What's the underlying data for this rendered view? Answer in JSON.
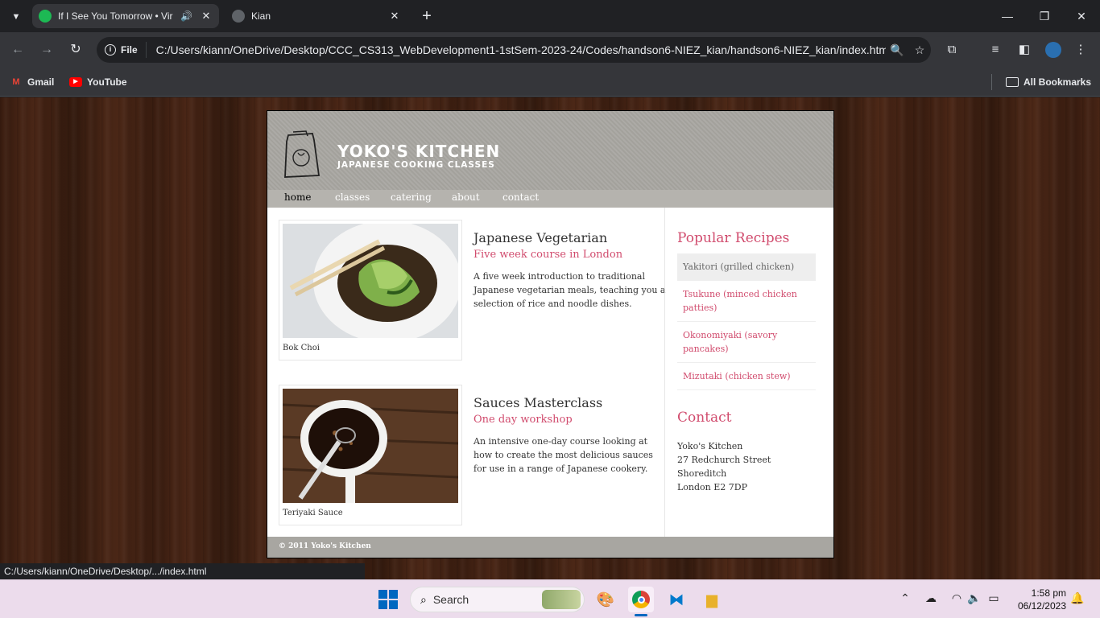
{
  "browser": {
    "tabs": [
      {
        "title": "If I See You Tomorrow • Vir",
        "active": true,
        "favicon": "spotify-icon",
        "favicon_color": "#1db954"
      },
      {
        "title": "Kian",
        "active": false,
        "favicon": "globe-icon"
      }
    ],
    "omnibox": {
      "chip_label": "File",
      "url": "C:/Users/kiann/OneDrive/Desktop/CCC_CS313_WebDevelopment1-1stSem-2023-24/Codes/handson6-NIEZ_kian/handson6-NIEZ_kian/index.html"
    },
    "bookmarks": [
      {
        "label": "Gmail",
        "icon": "gmail-icon"
      },
      {
        "label": "YouTube",
        "icon": "youtube-icon"
      }
    ],
    "all_bookmarks_label": "All Bookmarks",
    "status_url": "C:/Users/kiann/OneDrive/Desktop/.../index.html"
  },
  "site": {
    "brand": "YOKO'S KITCHEN",
    "brand_subtitle": "JAPANESE COOKING CLASSES",
    "nav": [
      "home",
      "classes",
      "catering",
      "about",
      "contact"
    ],
    "articles": [
      {
        "caption": "Bok Choi",
        "title": "Japanese Vegetarian",
        "subtitle": "Five week course in London",
        "body": "A five week introduction to traditional Japanese vegetarian meals, teaching you a selection of rice and noodle dishes."
      },
      {
        "caption": "Teriyaki Sauce",
        "title": "Sauces Masterclass",
        "subtitle": "One day workshop",
        "body": "An intensive one-day course looking at how to create the most delicious sauces for use in a range of Japanese cookery."
      }
    ],
    "popular_heading": "Popular Recipes",
    "recipes": [
      "Yakitori (grilled chicken)",
      "Tsukune (minced chicken patties)",
      "Okonomiyaki (savory pancakes)",
      "Mizutaki (chicken stew)"
    ],
    "contact_heading": "Contact",
    "contact_lines": [
      "Yoko's Kitchen",
      "27 Redchurch Street",
      "Shoreditch",
      "London E2 7DP"
    ],
    "footer": "© 2011 Yoko's Kitchen",
    "accent_color": "#d14c6e"
  },
  "taskbar": {
    "search_label": "Search",
    "time": "1:58 pm",
    "date": "06/12/2023"
  }
}
